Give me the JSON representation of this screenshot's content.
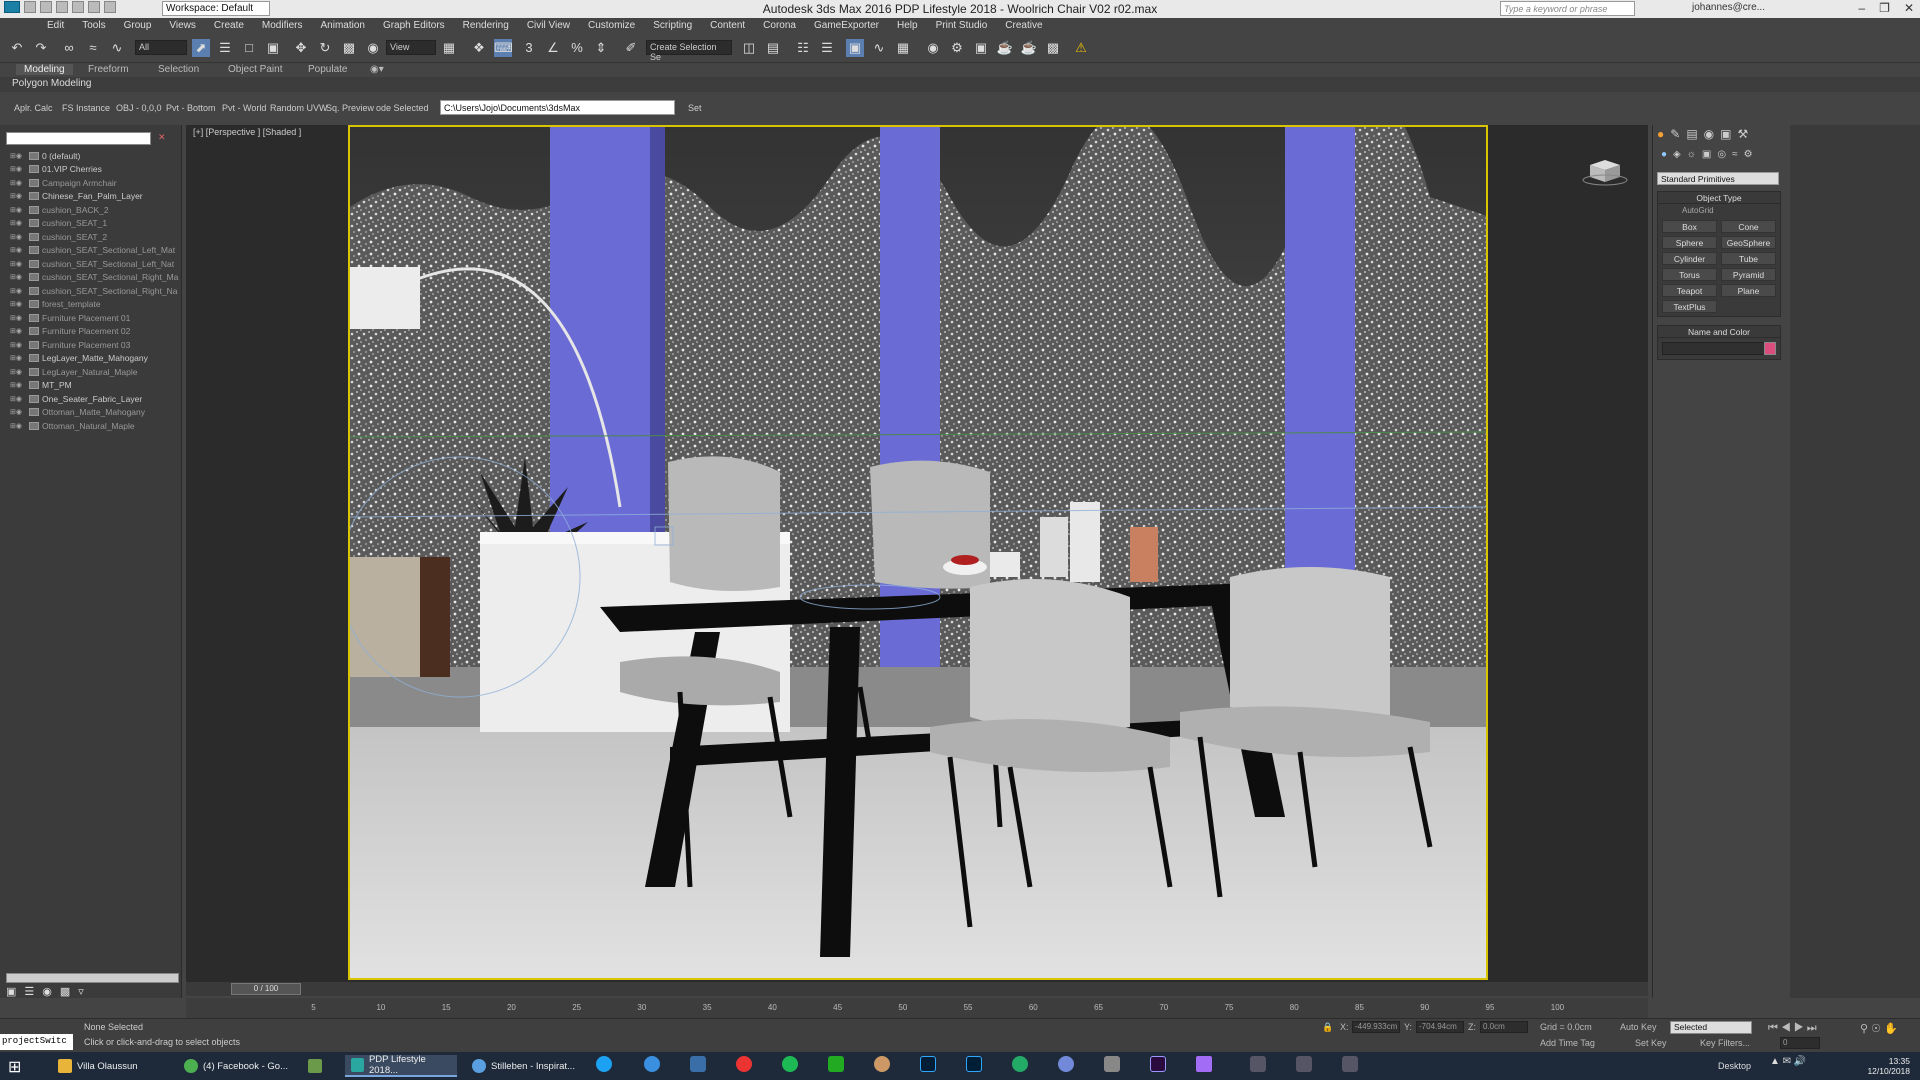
{
  "app": {
    "title": "Autodesk 3ds Max 2016    PDP Lifestyle 2018 - Woolrich Chair V02 r02.max",
    "workspace": "Workspace: Default",
    "search_placeholder": "Type a keyword or phrase",
    "user": "johannes@cre..."
  },
  "menu": [
    "Edit",
    "Tools",
    "Group",
    "Views",
    "Create",
    "Modifiers",
    "Animation",
    "Graph Editors",
    "Rendering",
    "Civil View",
    "Customize",
    "Scripting",
    "Content",
    "Corona",
    "GameExporter",
    "Help",
    "Print Studio",
    "Creative"
  ],
  "toolbar": {
    "selection_filter": "All",
    "ref_coord": "View",
    "named_selection": "Create Selection Se"
  },
  "ribbon": {
    "tabs": [
      "Modeling",
      "Freeform",
      "Selection",
      "Object Paint",
      "Populate"
    ],
    "active": "Modeling",
    "panel": "Polygon Modeling"
  },
  "infobar": {
    "items": [
      "Aplr. Calc",
      "FS Instance",
      "OBJ - 0,0,0",
      "Pvt - Bottom",
      "Pvt - World",
      "Random UVW",
      "Sq. Preview",
      "ode Selected"
    ],
    "path": "C:\\Users\\Jojo\\Documents\\3dsMax",
    "set_label": "Set"
  },
  "viewport": {
    "label": "[+] [Perspective ] [Shaded ]"
  },
  "layers": [
    {
      "name": "0 (default)",
      "dim": false
    },
    {
      "name": "01.VIP Cherries",
      "dim": false
    },
    {
      "name": "Campaign Armchair",
      "dim": true
    },
    {
      "name": "Chinese_Fan_Palm_Layer",
      "dim": false
    },
    {
      "name": "cushion_BACK_2",
      "dim": true
    },
    {
      "name": "cushion_SEAT_1",
      "dim": true
    },
    {
      "name": "cushion_SEAT_2",
      "dim": true
    },
    {
      "name": "cushion_SEAT_Sectional_Left_Mat",
      "dim": true
    },
    {
      "name": "cushion_SEAT_Sectional_Left_Nat",
      "dim": true
    },
    {
      "name": "cushion_SEAT_Sectional_Right_Ma",
      "dim": true
    },
    {
      "name": "cushion_SEAT_Sectional_Right_Na",
      "dim": true
    },
    {
      "name": "forest_template",
      "dim": true
    },
    {
      "name": "Furniture Placement 01",
      "dim": true
    },
    {
      "name": "Furniture Placement 02",
      "dim": true
    },
    {
      "name": "Furniture Placement 03",
      "dim": true
    },
    {
      "name": "LegLayer_Matte_Mahogany",
      "dim": false
    },
    {
      "name": "LegLayer_Natural_Maple",
      "dim": true
    },
    {
      "name": "MT_PM",
      "dim": false
    },
    {
      "name": "One_Seater_Fabric_Layer",
      "dim": false
    },
    {
      "name": "Ottoman_Matte_Mahogany",
      "dim": true
    },
    {
      "name": "Ottoman_Natural_Maple",
      "dim": true
    }
  ],
  "command_panel": {
    "category": "Standard Primitives",
    "object_type_title": "Object Type",
    "autogrid": "AutoGrid",
    "buttons": [
      "Box",
      "Cone",
      "Sphere",
      "GeoSphere",
      "Cylinder",
      "Tube",
      "Torus",
      "Pyramid",
      "Teapot",
      "Plane",
      "TextPlus"
    ],
    "name_color_title": "Name and Color",
    "color": "#d94e7c"
  },
  "timeline": {
    "frame": "0 / 100",
    "ticks": [
      "5",
      "10",
      "15",
      "20",
      "25",
      "30",
      "35",
      "40",
      "45",
      "50",
      "55",
      "60",
      "65",
      "70",
      "75",
      "80",
      "85",
      "90",
      "95",
      "100"
    ]
  },
  "status": {
    "maxscript": "projectSwitc",
    "selected": "None Selected",
    "prompt": "Click or click-and-drag to select objects",
    "x_label": "X:",
    "y_label": "Y:",
    "z_label": "Z:",
    "x_value": "-449.933cm",
    "y_value": "-704.94cm",
    "z_value": "0.0cm",
    "grid": "Grid = 0.0cm",
    "add_time_tag": "Add Time Tag",
    "auto_key": "Auto Key",
    "set_key": "Set Key",
    "key_filters": "Key Filters...",
    "sel_mode": "Selected",
    "frame_field": "0"
  },
  "taskbar": {
    "items": [
      {
        "label": "Villa Olaussun",
        "color": "#e8b43a"
      },
      {
        "label": "(4) Facebook - Go...",
        "color": "#4caf50"
      },
      {
        "label": "",
        "color": "#6a9a4a"
      },
      {
        "label": "PDP Lifestyle 2018...",
        "color": "#2aa7a0"
      },
      {
        "label": "Stilleben - Inspirat...",
        "color": "#5aa0e0"
      }
    ],
    "desktop": "Desktop",
    "time": "13:35",
    "date": "12/10/2018"
  }
}
